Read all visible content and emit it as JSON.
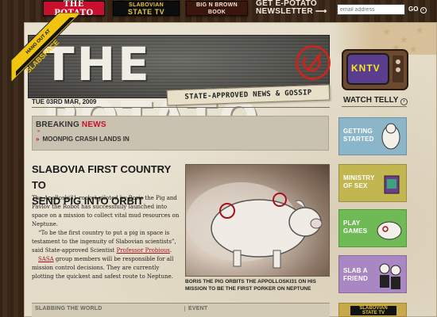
{
  "topnav": {
    "potato_label": "THE POTATO",
    "tv_line1": "SLABOVIAN",
    "tv_line2": "STATE TV",
    "book_line1": "BIG N BROWN",
    "book_line2": "BOOK",
    "newsletter_line1": "GET E-POTATO",
    "newsletter_line2": "NEWSLETTER",
    "arrow": "⟶",
    "email_placeholder": "email address",
    "go_label": "GO"
  },
  "masthead": {
    "title": "THE POTATO",
    "tagline": "STATE-APPROVED NEWS & GOSSIP",
    "date": "TUE 03RD MAR, 2009",
    "sticker_line1": "HANG OUT AT",
    "sticker_line2": "SLABSPACE"
  },
  "tv": {
    "screen_text": "KNTV",
    "watch_label": "WATCH TELLY"
  },
  "breaking": {
    "title_part1": "BREAKING ",
    "title_part2": "NEWS",
    "item": "MOONPIG CRASH LANDS IN"
  },
  "article": {
    "headline_line1": "SLABOVIA FIRST COUNTRY TO",
    "headline_line2": "SEND PIG INTO ORBIT",
    "p1": "The Apolloski31 rocket piloted by Boris the Pig and Pavlov the Robot has successfully launched into space on a mission to collect vital mud resources on Neptune.",
    "p2_start": "“To be the first country to put a pig in space is testament to the ingenuity of Slabovian scientists”, said State-approved Scientist ",
    "p2_link": "Professor Probious",
    "p2_end": ".",
    "p3_link": "SASA",
    "p3_rest": " group members will be responsible for all mission control decisions. They are currently plotting the quickest and safest route to Neptune.",
    "caption": "BORIS THE PIG ORBITS THE APPOLLOSKI31 ON HIS MISSION TO BE THE FIRST PORKER ON NEPTUNE"
  },
  "table": {
    "col1": "SLABBING THE WORLD",
    "col2": "EVENT"
  },
  "sidebar": [
    {
      "line1": "GETTING",
      "line2": "STARTED",
      "color": "#8bb6c9"
    },
    {
      "line1": "MINISTRY",
      "line2": "OF SEX",
      "color": "#c2b651"
    },
    {
      "line1": "PLAY",
      "line2": "GAMES",
      "color": "#6fba55"
    },
    {
      "line1": "SLAB A",
      "line2": "FRIEND",
      "color": "#a987c2"
    }
  ],
  "sidebar_bottom": {
    "line1": "SLABOVIAN",
    "line2": "STATE TV"
  },
  "colors": {
    "accent_red": "#c8102e",
    "paper": "#e4dcc8",
    "masthead": "#555555"
  }
}
